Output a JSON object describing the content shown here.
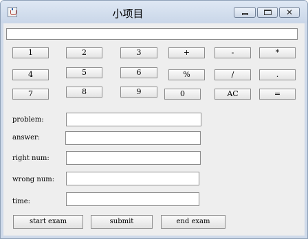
{
  "window": {
    "title": "小项目",
    "close_glyph": "✕"
  },
  "display": {
    "value": ""
  },
  "keys": {
    "row1": [
      "1",
      "2",
      "3",
      "+",
      "-",
      "*"
    ],
    "row2": [
      "4",
      "5",
      "6",
      "%",
      "/",
      "."
    ],
    "row3": [
      "7",
      "8",
      "9",
      "0",
      "AC",
      "="
    ]
  },
  "form": {
    "problem_label": "problem:",
    "problem_value": "",
    "answer_label": "answer:",
    "answer_value": "",
    "right_label": "right num:",
    "right_value": "",
    "wrong_label": "wrong num:",
    "wrong_value": "",
    "time_label": "time:",
    "time_value": ""
  },
  "actions": {
    "start": "start exam",
    "submit": "submit",
    "end": "end exam"
  }
}
